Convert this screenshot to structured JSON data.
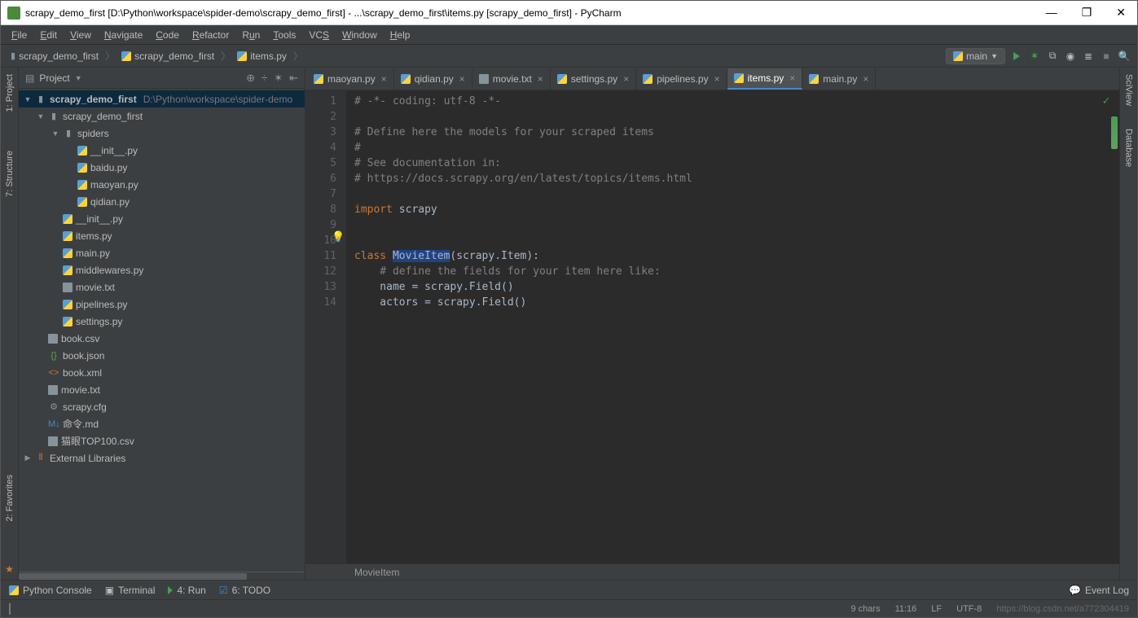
{
  "titlebar": {
    "title": "scrapy_demo_first [D:\\Python\\workspace\\spider-demo\\scrapy_demo_first] - ...\\scrapy_demo_first\\items.py [scrapy_demo_first] - PyCharm"
  },
  "menubar": [
    "File",
    "Edit",
    "View",
    "Navigate",
    "Code",
    "Refactor",
    "Run",
    "Tools",
    "VCS",
    "Window",
    "Help"
  ],
  "breadcrumb": {
    "root": "scrapy_demo_first",
    "mid": "scrapy_demo_first",
    "file": "items.py"
  },
  "run_config": "main",
  "sidebar": {
    "title": "Project",
    "tree": {
      "root": "scrapy_demo_first",
      "root_path": "D:\\Python\\workspace\\spider-demo",
      "pkg": "scrapy_demo_first",
      "spiders": "spiders",
      "spider_files": [
        "__init__.py",
        "baidu.py",
        "maoyan.py",
        "qidian.py"
      ],
      "pkg_files": [
        "__init__.py",
        "items.py",
        "main.py",
        "middlewares.py",
        "movie.txt",
        "pipelines.py",
        "settings.py"
      ],
      "root_files": [
        "book.csv",
        "book.json",
        "book.xml",
        "movie.txt",
        "scrapy.cfg",
        "命令.md",
        "猫眼TOP100.csv"
      ],
      "external": "External Libraries"
    }
  },
  "tabs": [
    {
      "label": "maoyan.py",
      "type": "py"
    },
    {
      "label": "qidian.py",
      "type": "py"
    },
    {
      "label": "movie.txt",
      "type": "txt"
    },
    {
      "label": "settings.py",
      "type": "py"
    },
    {
      "label": "pipelines.py",
      "type": "py"
    },
    {
      "label": "items.py",
      "type": "py",
      "active": true
    },
    {
      "label": "main.py",
      "type": "py"
    }
  ],
  "code": {
    "lines": [
      {
        "n": 1,
        "type": "comment",
        "t": "# -*- coding: utf-8 -*-"
      },
      {
        "n": 2,
        "type": "blank",
        "t": ""
      },
      {
        "n": 3,
        "type": "comment",
        "t": "# Define here the models for your scraped items"
      },
      {
        "n": 4,
        "type": "comment",
        "t": "#"
      },
      {
        "n": 5,
        "type": "comment",
        "t": "# See documentation in:"
      },
      {
        "n": 6,
        "type": "comment",
        "t": "# https://docs.scrapy.org/en/latest/topics/items.html"
      },
      {
        "n": 7,
        "type": "blank",
        "t": ""
      },
      {
        "n": 8,
        "type": "import",
        "kw": "import",
        "rest": " scrapy"
      },
      {
        "n": 9,
        "type": "blank",
        "t": ""
      },
      {
        "n": 10,
        "type": "blank",
        "t": ""
      },
      {
        "n": 11,
        "type": "class",
        "kw": "class",
        "name": "MovieItem",
        "rest": "(scrapy.Item):"
      },
      {
        "n": 12,
        "type": "comment",
        "t": "    # define the fields for your item here like:"
      },
      {
        "n": 13,
        "type": "code",
        "t": "    name = scrapy.Field()"
      },
      {
        "n": 14,
        "type": "code",
        "t": "    actors = scrapy.Field()"
      }
    ]
  },
  "breadcrumb_bottom": "MovieItem",
  "left_gutter": [
    "1: Project",
    "7: Structure"
  ],
  "left_gutter_bottom": "2: Favorites",
  "right_gutter": [
    "SciView",
    "Database"
  ],
  "bottom_toolbar": {
    "python_console": "Python Console",
    "terminal": "Terminal",
    "run": "4: Run",
    "todo": "6: TODO",
    "event_log": "Event Log"
  },
  "statusbar": {
    "chars": "9 chars",
    "position": "11:16",
    "lf": "LF",
    "encoding": "UTF-8",
    "watermark": "https://blog.csdn.net/a772304419"
  }
}
